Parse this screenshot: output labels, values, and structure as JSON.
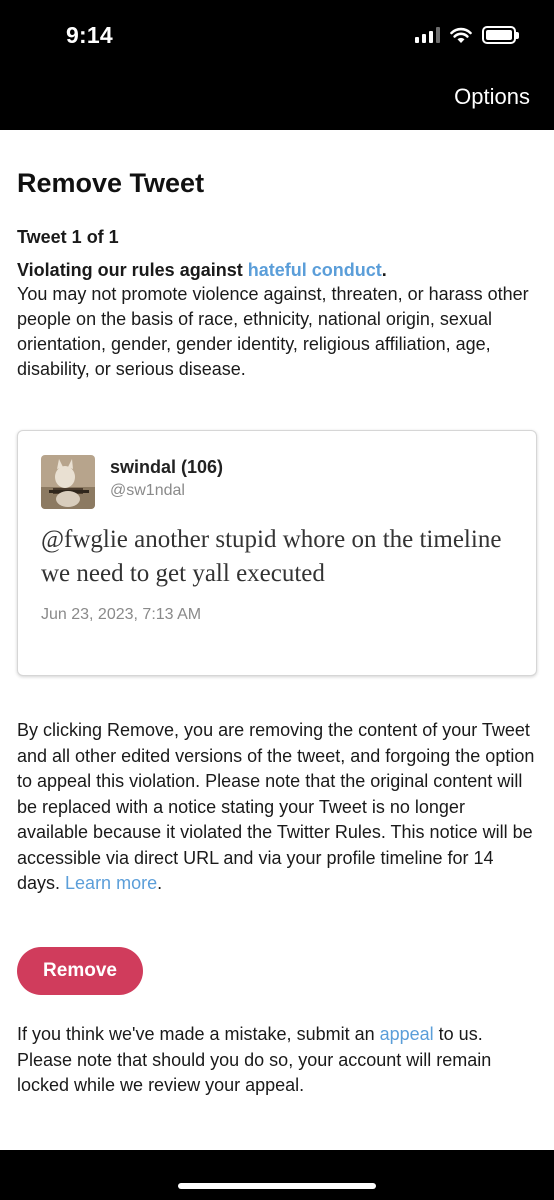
{
  "status_bar": {
    "time": "9:14"
  },
  "header": {
    "options_label": "Options"
  },
  "page": {
    "title": "Remove Tweet",
    "tweet_count": "Tweet 1 of 1",
    "rule_heading_prefix": "Violating our rules against ",
    "rule_link": "hateful conduct",
    "rule_heading_suffix": ".",
    "rule_text": "You may not promote violence against, threaten, or harass other people on the basis of race, ethnicity, national origin, sexual orientation, gender, gender identity, religious affiliation, age, disability, or serious disease."
  },
  "tweet": {
    "author_name": "swindal (106)",
    "author_handle": "@sw1ndal",
    "text": "@fwglie another stupid whore on the timeline we need to get yall executed",
    "date": "Jun 23, 2023, 7:13 AM"
  },
  "notice": {
    "text": "By clicking Remove, you are removing the content of your Tweet and all other edited versions of the tweet, and forgoing the option to appeal this violation. Please note that the original content will be replaced with a notice stating your Tweet is no longer available because it violated the Twitter Rules. This notice will be accessible via direct URL and via your profile timeline for 14 days. ",
    "learn_more": "Learn more",
    "end": "."
  },
  "actions": {
    "remove_label": "Remove"
  },
  "appeal": {
    "prefix": "If you think we've made a mistake, submit an ",
    "link": "appeal",
    "suffix": " to us. Please note that should you do so, your account will remain locked while we review your appeal."
  },
  "colors": {
    "link": "#5b9ed9",
    "remove_button": "#d03c5c",
    "bar": "#000000"
  }
}
